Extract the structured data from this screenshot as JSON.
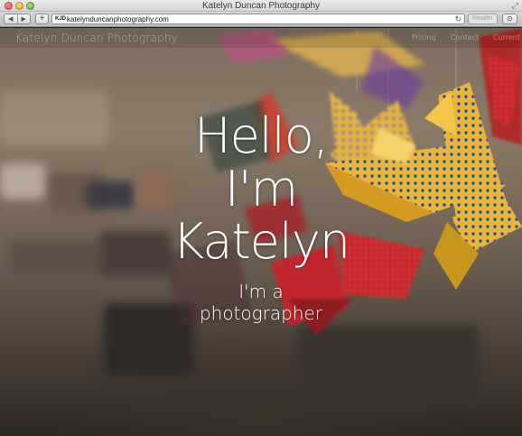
{
  "window": {
    "title": "Katelyn Duncan Photography"
  },
  "toolbar": {
    "back_icon": "◀",
    "forward_icon": "▶",
    "add_icon": "+",
    "favicon": "KJD",
    "url": "katelynduncanphotography.com",
    "reader_label": "Reader"
  },
  "site": {
    "name": "Katelyn Duncan Photography",
    "nav": [
      "Pricing",
      "Contact",
      "Current"
    ]
  },
  "hero": {
    "headline_lines": [
      "Hello,",
      "I'm",
      "Katelyn"
    ],
    "subtitle_lines": [
      "I'm a",
      "photographer"
    ]
  },
  "colors": {
    "crane_yellow": "#e8b73a",
    "crane_red": "#c8242a",
    "crane_blue_pattern": "#3a4a9a",
    "wall": "#7e6f60"
  }
}
